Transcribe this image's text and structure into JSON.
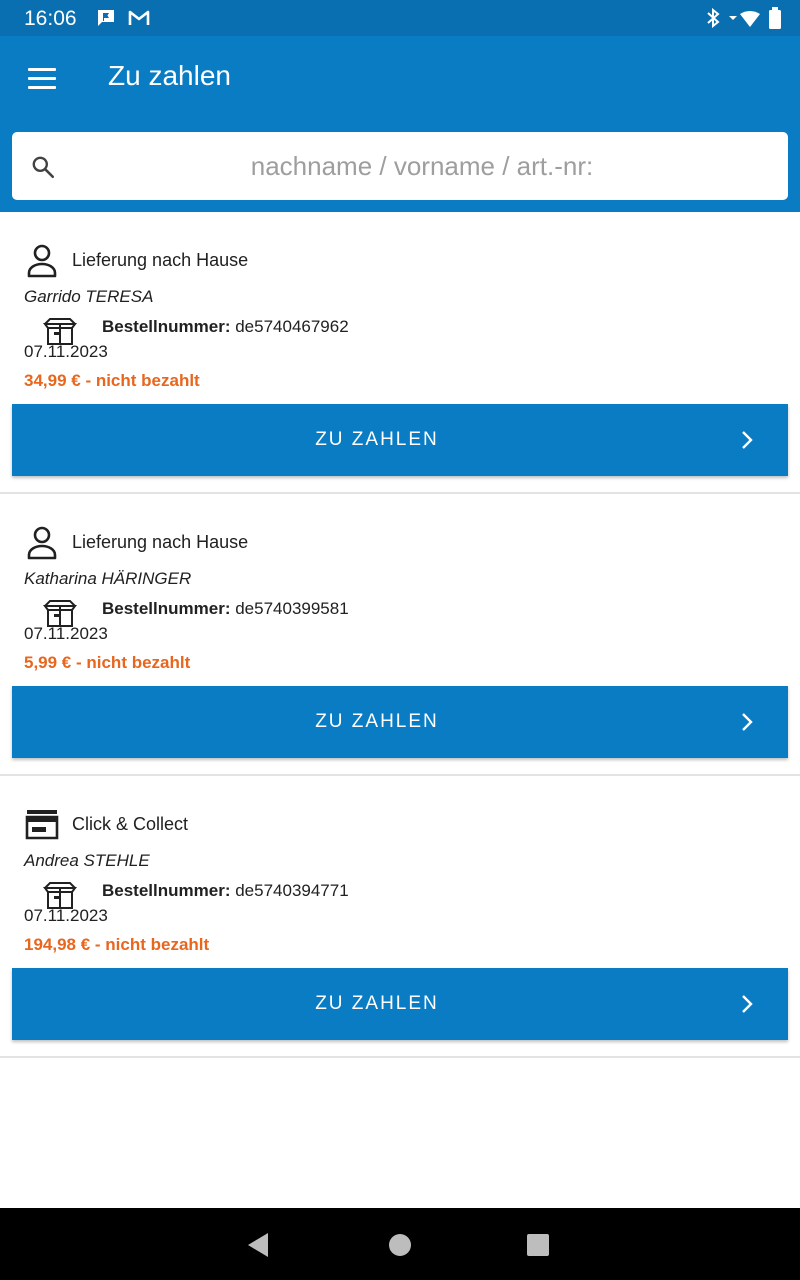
{
  "status_bar": {
    "time": "16:06",
    "icons": [
      "chat-notification-icon",
      "gmail-icon",
      "bluetooth-icon",
      "wifi-icon",
      "battery-icon"
    ]
  },
  "app_bar": {
    "title": "Zu zahlen",
    "menu_icon": "hamburger-menu-icon"
  },
  "search": {
    "placeholder": "nachname / vorname / art.-nr:",
    "value": ""
  },
  "colors": {
    "primary": "#0a7cc4",
    "status_bar": "#0a6fb0",
    "unpaid": "#e8661e"
  },
  "orders": [
    {
      "delivery_icon": "person-icon",
      "delivery_type": "Lieferung nach Hause",
      "customer": "Garrido TERESA",
      "order_label": "Bestellnummer:",
      "order_number": "de5740467962",
      "date": "07.11.2023",
      "status": "34,99 € - nicht bezahlt",
      "button_label": "ZU ZAHLEN"
    },
    {
      "delivery_icon": "person-icon",
      "delivery_type": "Lieferung nach Hause",
      "customer": "Katharina HÄRINGER",
      "order_label": "Bestellnummer:",
      "order_number": "de5740399581",
      "date": "07.11.2023",
      "status": "5,99 € - nicht bezahlt",
      "button_label": "ZU ZAHLEN"
    },
    {
      "delivery_icon": "store-icon",
      "delivery_type": "Click & Collect",
      "customer": "Andrea STEHLE",
      "order_label": "Bestellnummer:",
      "order_number": "de5740394771",
      "date": "07.11.2023",
      "status": "194,98 € - nicht bezahlt",
      "button_label": "ZU ZAHLEN"
    }
  ],
  "nav_bar": {
    "icons": [
      "back-icon",
      "home-icon",
      "recents-icon"
    ]
  }
}
